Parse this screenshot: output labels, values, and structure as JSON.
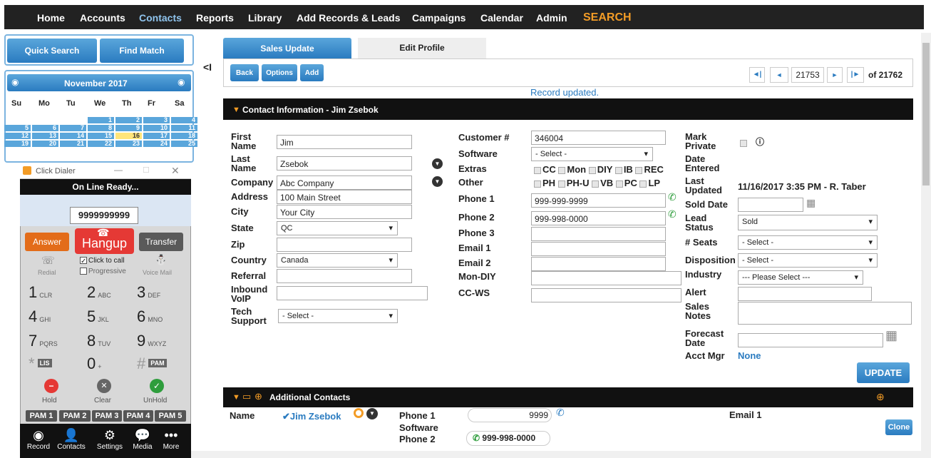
{
  "nav": {
    "items": [
      "Home",
      "Accounts",
      "Contacts",
      "Reports",
      "Library",
      "Add Records & Leads",
      "Campaigns",
      "Calendar",
      "Admin"
    ],
    "search": "SEARCH"
  },
  "left": {
    "quick_search": "Quick Search",
    "find_match": "Find Match",
    "collapse": "<I"
  },
  "calendar": {
    "title": "November 2017",
    "days": [
      "Su",
      "Mo",
      "Tu",
      "We",
      "Th",
      "Fr",
      "Sa"
    ],
    "rows": [
      [
        "",
        "",
        "",
        "1",
        "2",
        "3",
        "4"
      ],
      [
        "5",
        "6",
        "7",
        "8",
        "9",
        "10",
        "11"
      ],
      [
        "12",
        "13",
        "14",
        "15",
        "16",
        "17",
        "18"
      ],
      [
        "19",
        "20",
        "21",
        "22",
        "23",
        "24",
        "25"
      ]
    ]
  },
  "dialer": {
    "title": "Click Dialer",
    "status": "On Line Ready...",
    "number": "9999999999",
    "answer": "Answer",
    "hangup": "Hangup",
    "transfer": "Transfer",
    "redial": "Redial",
    "click_to_call": "Click to call",
    "progressive": "Progressive",
    "voicemail": "Voice Mail",
    "keys": [
      [
        "1",
        "CLR"
      ],
      [
        "2",
        "ABC"
      ],
      [
        "3",
        "DEF"
      ],
      [
        "4",
        "GHI"
      ],
      [
        "5",
        "JKL"
      ],
      [
        "6",
        "MNO"
      ],
      [
        "7",
        "PQRS"
      ],
      [
        "8",
        "TUV"
      ],
      [
        "9",
        "WXYZ"
      ],
      [
        "*",
        "LIS"
      ],
      [
        "0",
        "+"
      ],
      [
        "#",
        "PAM"
      ]
    ],
    "hold": "Hold",
    "clear": "Clear",
    "unhold": "UnHold",
    "pams": [
      "PAM 1",
      "PAM 2",
      "PAM 3",
      "PAM 4",
      "PAM 5"
    ],
    "bottom": [
      "Record",
      "Contacts",
      "Settings",
      "Media",
      "More"
    ]
  },
  "tabs": {
    "sales_update": "Sales Update",
    "edit_profile": "Edit Profile"
  },
  "toolbar": {
    "back": "Back",
    "options": "Options",
    "add": "Add",
    "record_number": "21753",
    "of_total": "of 21762"
  },
  "message": "Record updated.",
  "contact_section": {
    "title": "Contact Information - Jim Zsebok"
  },
  "col1": {
    "first_name_label": "First Name",
    "first_name": "Jim",
    "last_name_label": "Last Name",
    "last_name": "Zsebok",
    "company_label": "Company",
    "company": "Abc Company",
    "address_label": "Address",
    "address": "100 Main Street",
    "city_label": "City",
    "city": "Your City",
    "state_label": "State",
    "state": "QC",
    "zip_label": "Zip",
    "zip": "",
    "country_label": "Country",
    "country": "Canada",
    "referral_label": "Referral",
    "inbound_label": "Inbound VoIP",
    "tech_label": "Tech Support",
    "tech": "- Select -"
  },
  "col2": {
    "customer_label": "Customer #",
    "customer": "346004",
    "software_label": "Software",
    "software": "- Select -",
    "extras_label": "Extras",
    "extras": [
      "CC",
      "Mon",
      "DIY",
      "IB",
      "REC"
    ],
    "other_label": "Other",
    "other": [
      "PH",
      "PH-U",
      "VB",
      "PC",
      "LP"
    ],
    "phone1_label": "Phone 1",
    "phone1": "999-999-9999",
    "phone2_label": "Phone 2",
    "phone2": "999-998-0000",
    "phone3_label": "Phone 3",
    "email1_label": "Email 1",
    "email2_label": "Email 2",
    "mondiy_label": "Mon-DIY",
    "ccws_label": "CC-WS"
  },
  "col3": {
    "mark_private_label": "Mark Private",
    "date_entered_label": "Date Entered",
    "last_updated_label": "Last Updated",
    "last_updated": "11/16/2017 3:35 PM - R. Taber",
    "sold_date_label": "Sold Date",
    "lead_status_label": "Lead Status",
    "lead_status": "Sold",
    "seats_label": "# Seats",
    "seats": "- Select -",
    "disposition_label": "Disposition",
    "disposition": "- Select -",
    "industry_label": "Industry",
    "industry": "--- Please Select ---",
    "alert_label": "Alert",
    "sales_notes_label": "Sales Notes",
    "forecast_label": "Forecast Date",
    "acct_mgr_label": "Acct Mgr",
    "acct_mgr": "None"
  },
  "update": "UPDATE",
  "additional": {
    "title": "Additional Contacts",
    "name_label": "Name",
    "name": "Jim Zsebok",
    "phone1_label": "Phone 1",
    "phone1": "9999",
    "software_label": "Software",
    "phone2_label": "Phone 2",
    "phone2": "999-998-0000",
    "email1_label": "Email 1",
    "clone": "Clone"
  }
}
